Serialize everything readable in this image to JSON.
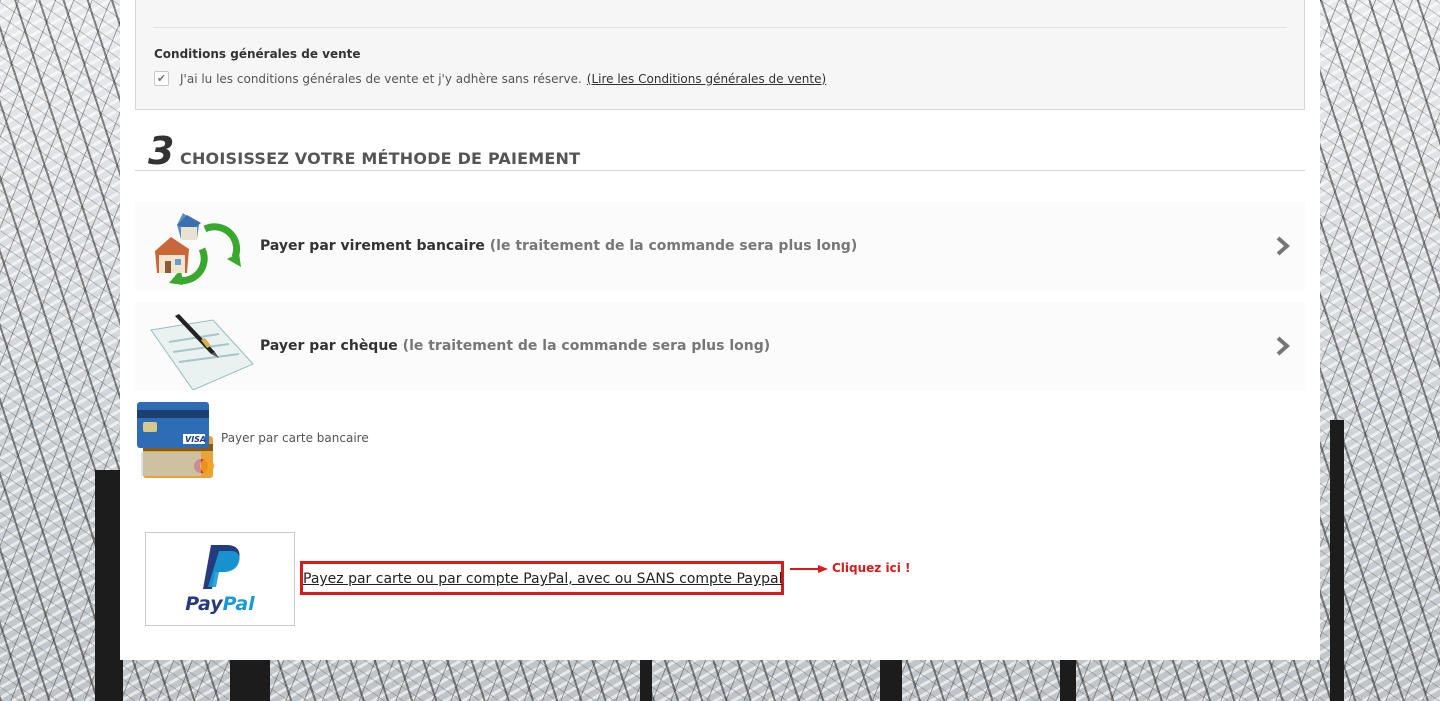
{
  "terms": {
    "title": "Conditions générales de vente",
    "checkbox_label": "J'ai lu les conditions générales de vente et j'y adhère sans réserve.",
    "checked": true,
    "link_label": "(Lire les Conditions générales de vente)"
  },
  "step": {
    "number": "3",
    "title": "CHOISISSEZ VOTRE MÉTHODE DE PAIEMENT"
  },
  "payment_options": [
    {
      "label": "Payer par virement bancaire",
      "note": "(le traitement de la commande sera plus long)",
      "icon": "bank-transfer-icon"
    },
    {
      "label": "Payer par chèque",
      "note": "(le traitement de la commande sera plus long)",
      "icon": "cheque-icon"
    }
  ],
  "card": {
    "label": "Payer par carte bancaire",
    "icon": "credit-cards-icon"
  },
  "paypal": {
    "logo_text_pay": "Pay",
    "logo_text_pal": "Pal",
    "link_label": "Payez par carte ou par compte PayPal, avec ou SANS compte Paypal",
    "callout": "Cliquez ici !"
  },
  "colors": {
    "accent_red": "#d51b1b",
    "paypal_dark": "#253b80",
    "paypal_light": "#179bd7"
  }
}
